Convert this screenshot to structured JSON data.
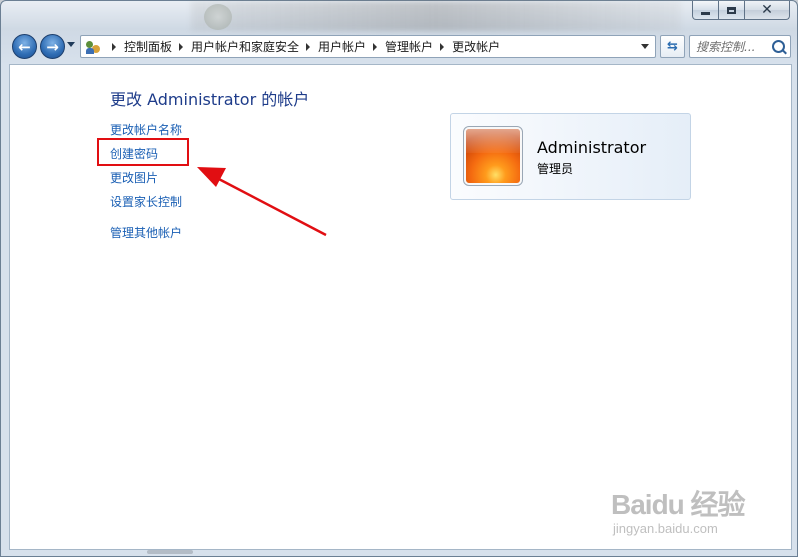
{
  "window": {
    "caption_buttons": {
      "minimize": "minimize-icon",
      "maximize": "maximize-icon",
      "close": "close-icon"
    }
  },
  "nav": {
    "back_icon": "arrow-left-icon",
    "forward_icon": "arrow-right-icon",
    "breadcrumb": [
      "控制面板",
      "用户帐户和家庭安全",
      "用户帐户",
      "管理帐户",
      "更改帐户"
    ],
    "search_placeholder": "搜索控制..."
  },
  "main": {
    "title": "更改 Administrator 的帐户",
    "links": [
      "更改帐户名称",
      "创建密码",
      "更改图片",
      "设置家长控制",
      "管理其他帐户"
    ],
    "highlighted_link_index": 1,
    "account": {
      "name": "Administrator",
      "role": "管理员"
    }
  },
  "annotation": {
    "color": "#e10e12"
  },
  "watermark": {
    "logo": "Baidu 经验",
    "url": "jingyan.baidu.com"
  }
}
